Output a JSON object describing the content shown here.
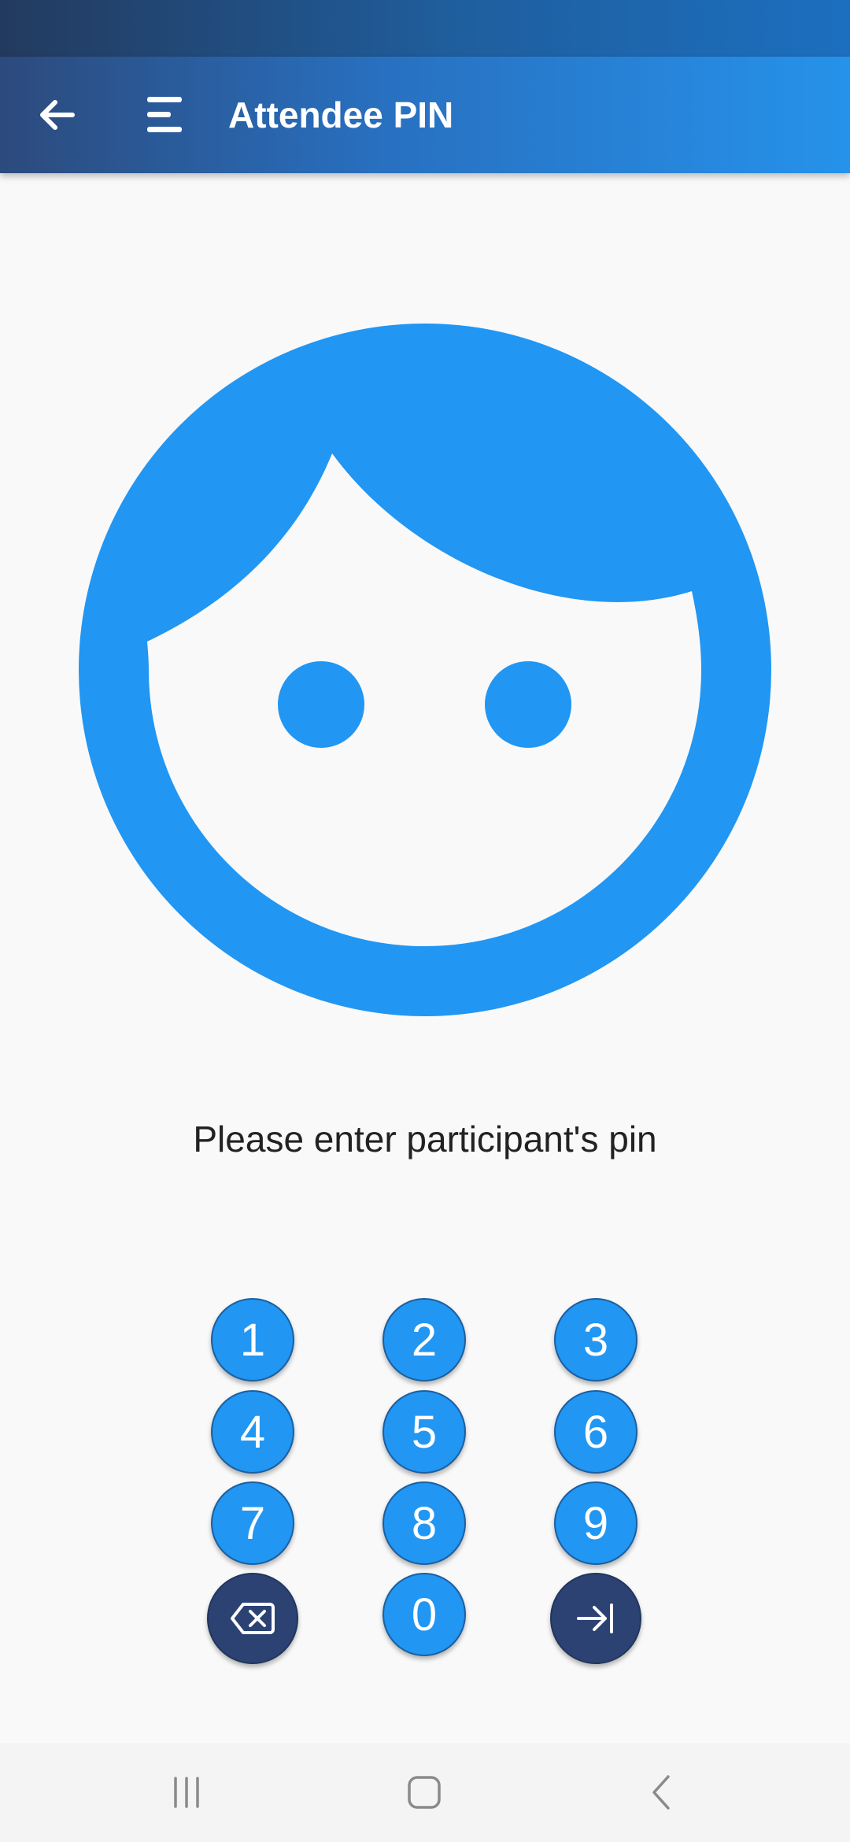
{
  "app_bar": {
    "title": "Attendee PIN",
    "back_icon": "arrow-back-icon",
    "menu_icon": "menu-icon"
  },
  "avatar_icon": "face-icon",
  "prompt": "Please enter participant's pin",
  "keypad": {
    "keys": [
      "1",
      "2",
      "3",
      "4",
      "5",
      "6",
      "7",
      "8",
      "9",
      "0"
    ],
    "backspace_icon": "backspace-icon",
    "submit_icon": "submit-arrow-icon"
  },
  "nav_bar": {
    "recents_icon": "recents-icon",
    "home_icon": "home-icon",
    "back_icon": "nav-back-icon"
  },
  "colors": {
    "accent": "#2196f3",
    "dark_accent": "#2b4273",
    "background": "#f9f9f9"
  }
}
